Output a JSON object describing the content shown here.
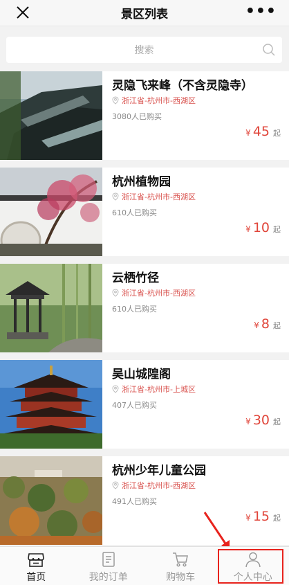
{
  "header": {
    "title": "景区列表",
    "close_icon": "close-icon",
    "more_icon": "more-icon"
  },
  "search": {
    "placeholder": "搜索"
  },
  "spots": [
    {
      "name": "灵隐飞来峰（不含灵隐寺）",
      "location": "浙江省-杭州市-西湖区",
      "sold": "3080人已购买",
      "currency": "¥",
      "price": "45",
      "suffix": "起"
    },
    {
      "name": "杭州植物园",
      "location": "浙江省-杭州市-西湖区",
      "sold": "610人已购买",
      "currency": "¥",
      "price": "10",
      "suffix": "起"
    },
    {
      "name": "云栖竹径",
      "location": "浙江省-杭州市-西湖区",
      "sold": "610人已购买",
      "currency": "¥",
      "price": "8",
      "suffix": "起"
    },
    {
      "name": "吴山城隍阁",
      "location": "浙江省-杭州市-上城区",
      "sold": "407人已购买",
      "currency": "¥",
      "price": "30",
      "suffix": "起"
    },
    {
      "name": "杭州少年儿童公园",
      "location": "浙江省-杭州市-西湖区",
      "sold": "491人已购买",
      "currency": "¥",
      "price": "15",
      "suffix": "起"
    }
  ],
  "tabs": [
    {
      "label": "首页",
      "icon": "shop-icon",
      "active": true
    },
    {
      "label": "我的订单",
      "icon": "order-icon",
      "active": false
    },
    {
      "label": "购物车",
      "icon": "cart-icon",
      "active": false
    },
    {
      "label": "个人中心",
      "icon": "user-icon",
      "active": false
    }
  ],
  "colors": {
    "accent": "#e0453a",
    "highlight": "#e8231d"
  }
}
